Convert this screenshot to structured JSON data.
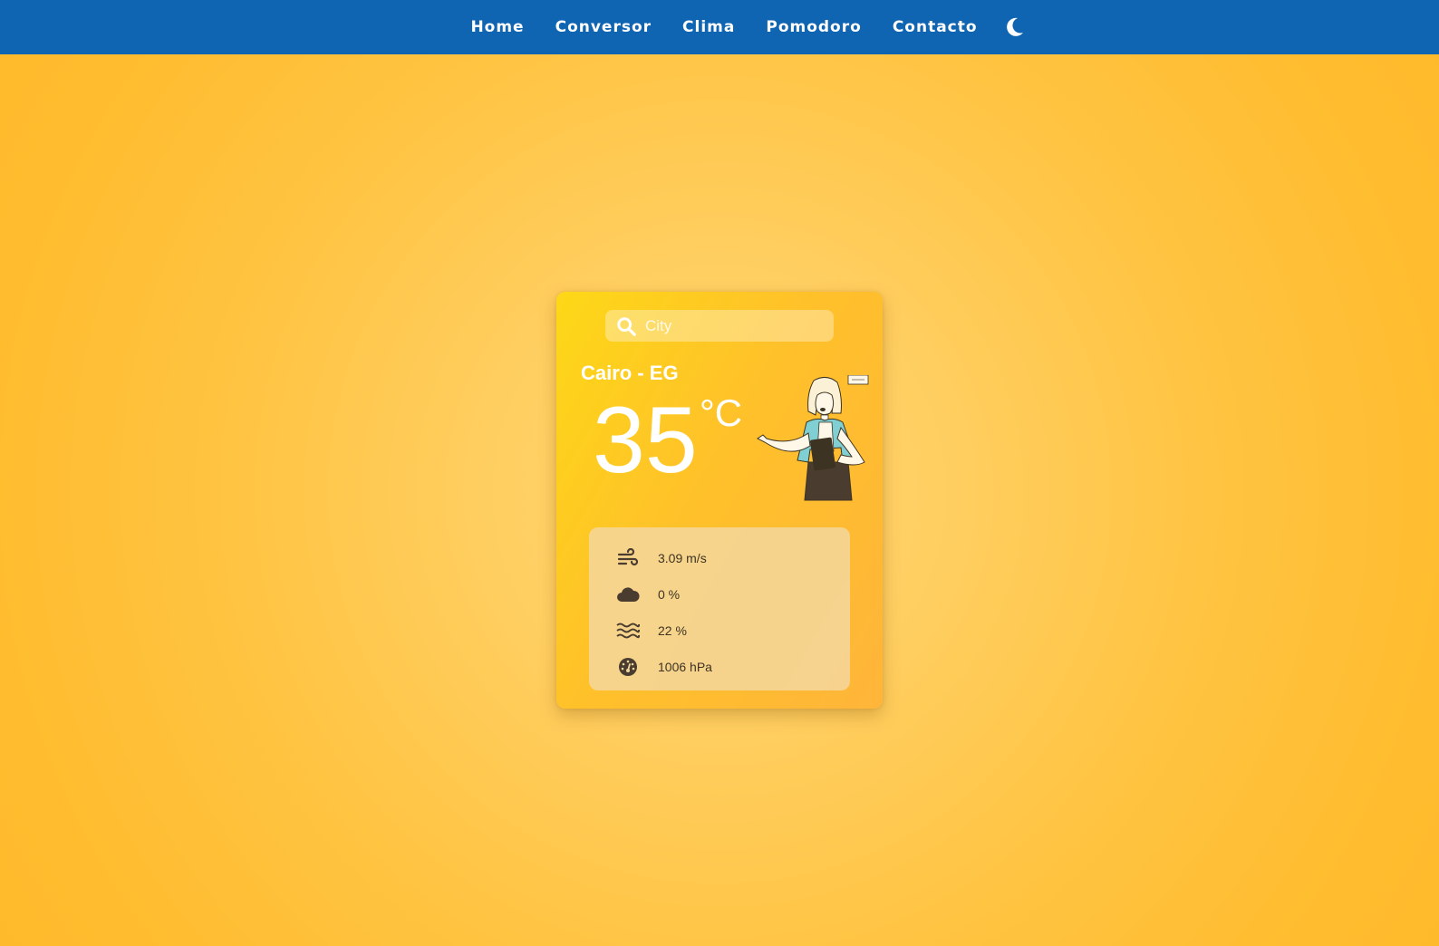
{
  "nav": {
    "items": [
      {
        "label": "Home"
      },
      {
        "label": "Conversor"
      },
      {
        "label": "Clima"
      },
      {
        "label": "Pomodoro"
      },
      {
        "label": "Contacto"
      }
    ],
    "theme_toggle_icon": "moon-icon"
  },
  "weather": {
    "search_placeholder": "City",
    "search_icon": "search-icon",
    "city": "Cairo - EG",
    "temperature": "35",
    "unit": "°C",
    "details": [
      {
        "icon": "wind-icon",
        "value": "3.09 m/s"
      },
      {
        "icon": "cloud-icon",
        "value": "0 %"
      },
      {
        "icon": "humidity-icon",
        "value": "22 %"
      },
      {
        "icon": "pressure-gauge-icon",
        "value": "1006 hPa"
      }
    ]
  },
  "colors": {
    "navbar": "#1065b3",
    "background": "#ffc443",
    "card_start": "#fdd817",
    "card_end": "#ffb53a",
    "detail_text": "#3d3322"
  }
}
